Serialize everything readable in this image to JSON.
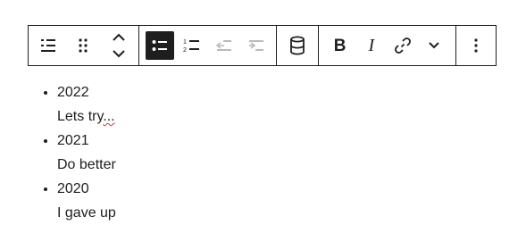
{
  "toolbar": {
    "buttons": {
      "list_block": "list-block-icon",
      "drag": "drag-handle-icon",
      "move": "move-up-down-icon",
      "unordered_list": "unordered-list-icon",
      "ordered_list": "ordered-list-icon",
      "outdent": "outdent-icon",
      "indent": "indent-icon",
      "database": "database-icon",
      "bold": "B",
      "italic": "I",
      "link": "link-icon",
      "more_rich": "chevron-down-icon",
      "options": "more-vertical-icon"
    },
    "active_color": "#1e1e1e"
  },
  "list": {
    "items": [
      {
        "title": "2022",
        "text_plain": "Lets try",
        "text_misspelled": "..."
      },
      {
        "title": "2021",
        "text": "Do better"
      },
      {
        "title": "2020",
        "text": "I gave up"
      }
    ]
  }
}
